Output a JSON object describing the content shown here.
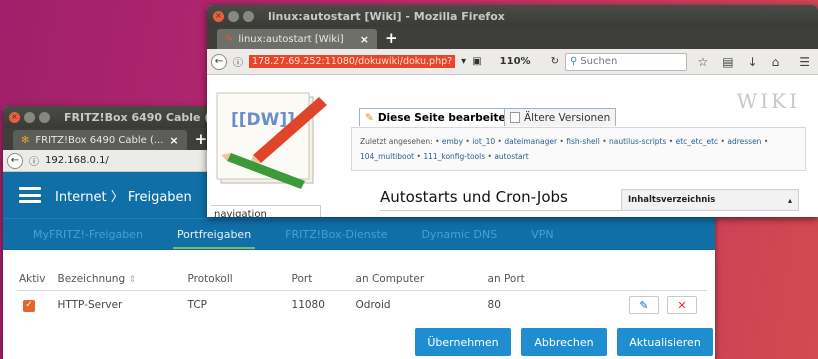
{
  "fritz": {
    "title": "FRITZ!Box 6490 Cable (kc",
    "tab_label": "FRITZ!Box 6490 Cable (...",
    "tab_close": "×",
    "new_tab": "+",
    "url": "192.168.0.1/",
    "breadcrumb": "Internet 〉 Freigaben",
    "tabs": [
      "MyFRITZ!-Freigaben",
      "Portfreigaben",
      "FRITZ!Box-Dienste",
      "Dynamic DNS",
      "VPN"
    ],
    "table": {
      "headers": [
        "Aktiv",
        "Bezeichnung",
        "Protokoll",
        "Port",
        "an Computer",
        "an Port"
      ],
      "rows": [
        {
          "active": true,
          "name": "HTTP-Server",
          "protocol": "TCP",
          "port": "11080",
          "computer": "Odroid",
          "to_port": "80"
        }
      ]
    },
    "buttons": {
      "apply": "Übernehmen",
      "cancel": "Abbrechen",
      "refresh": "Aktualisieren"
    },
    "colors": {
      "header": "#0f6fa6",
      "button": "#1e8ed1",
      "checkbox": "#e2662a",
      "active_tab_underline": "#8cc34a"
    }
  },
  "firefox": {
    "title": "linux:autostart [Wiki] - Mozilla Firefox",
    "tab_label": "linux:autostart [Wiki]",
    "tab_close": "×",
    "new_tab": "+",
    "url": "178.27.69.252:11080/dokuwiki/doku.php?",
    "zoom": "110%",
    "search_placeholder": "Suchen",
    "wiki": {
      "logo_text": "[[DW]]",
      "brand": "WIKI",
      "nav_label": "navigation",
      "tab_edit": "Diese Seite bearbeiten",
      "tab_versions": "Ältere Versionen",
      "breadcrumb_intro": "Zuletzt angesehen:",
      "breadcrumb_items": [
        "emby",
        "iot_10",
        "dateimanager",
        "fish-shell",
        "nautilus-scripts",
        "etc_etc_etc",
        "adressen",
        "104_multiboot",
        "111_konfig-tools",
        "autostart"
      ],
      "heading": "Autostarts und Cron-Jobs",
      "toc_label": "Inhaltsverzeichnis"
    }
  }
}
